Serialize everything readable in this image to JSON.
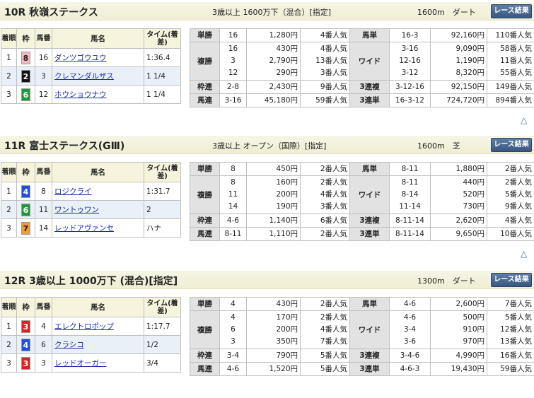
{
  "races": [
    {
      "title": "10R 秋嶺ステークス",
      "conditions": "3歳以上 1600万下（混合）[指定]",
      "distance": "1600m　ダート",
      "results_button": "レース結果",
      "headers": {
        "rank": "着順",
        "waku": "枠",
        "umaban": "馬番",
        "horse": "馬名",
        "time": "タイム(着差)"
      },
      "results": [
        {
          "rank": "1",
          "waku": "8",
          "waku_bg": "#f9b7c0",
          "waku_fg": "#222222",
          "umaban": "16",
          "horse": "ダンツゴウユウ",
          "time": "1:36.4"
        },
        {
          "rank": "2",
          "waku": "2",
          "waku_bg": "#111111",
          "waku_fg": "#ffffff",
          "umaban": "3",
          "horse": "クレマンダルザス",
          "time": "1 1/4"
        },
        {
          "rank": "3",
          "waku": "6",
          "waku_bg": "#1f9a3a",
          "waku_fg": "#ffffff",
          "umaban": "12",
          "horse": "ホウショウナウ",
          "time": "1 1/4"
        }
      ],
      "payouts": {
        "tansho": {
          "label": "単勝",
          "comb": "16",
          "amount": "1,280円",
          "pop": "4番人気"
        },
        "fukusho": {
          "label": "複勝",
          "combs": [
            "16",
            "3",
            "12"
          ],
          "amounts": [
            "430円",
            "2,790円",
            "290円"
          ],
          "pops": [
            "4番人気",
            "13番人気",
            "3番人気"
          ]
        },
        "wakuren": {
          "label": "枠連",
          "comb": "2-8",
          "amount": "2,430円",
          "pop": "9番人気"
        },
        "umaren": {
          "label": "馬連",
          "comb": "3-16",
          "amount": "45,180円",
          "pop": "59番人気"
        },
        "umatan": {
          "label": "馬単",
          "comb": "16-3",
          "amount": "92,160円",
          "pop": "110番人気"
        },
        "wide": {
          "label": "ワイド",
          "combs": [
            "3-16",
            "12-16",
            "3-12"
          ],
          "amounts": [
            "9,090円",
            "1,190円",
            "8,320円"
          ],
          "pops": [
            "58番人気",
            "11番人気",
            "55番人気"
          ]
        },
        "sanrenpuku": {
          "label": "3連複",
          "comb": "3-12-16",
          "amount": "92,150円",
          "pop": "149番人気"
        },
        "sanrentan": {
          "label": "3連単",
          "comb": "16-3-12",
          "amount": "724,720円",
          "pop": "894番人気"
        }
      }
    },
    {
      "title": "11R 富士ステークス(GⅢ)",
      "conditions": "3歳以上 オープン（国際）[指定]",
      "distance": "1600m　芝",
      "results_button": "レース結果",
      "headers": {
        "rank": "着順",
        "waku": "枠",
        "umaban": "馬番",
        "horse": "馬名",
        "time": "タイム(着差)"
      },
      "results": [
        {
          "rank": "1",
          "waku": "4",
          "waku_bg": "#1d4fd8",
          "waku_fg": "#ffffff",
          "umaban": "8",
          "horse": "ロジクライ",
          "time": "1:31.7"
        },
        {
          "rank": "2",
          "waku": "6",
          "waku_bg": "#1f9a3a",
          "waku_fg": "#ffffff",
          "umaban": "11",
          "horse": "ワントゥワン",
          "time": "2"
        },
        {
          "rank": "3",
          "waku": "7",
          "waku_bg": "#f39a3a",
          "waku_fg": "#222222",
          "umaban": "14",
          "horse": "レッドアヴァンセ",
          "time": "ハナ"
        }
      ],
      "payouts": {
        "tansho": {
          "label": "単勝",
          "comb": "8",
          "amount": "450円",
          "pop": "2番人気"
        },
        "fukusho": {
          "label": "複勝",
          "combs": [
            "8",
            "11",
            "14"
          ],
          "amounts": [
            "160円",
            "200円",
            "190円"
          ],
          "pops": [
            "2番人気",
            "4番人気",
            "3番人気"
          ]
        },
        "wakuren": {
          "label": "枠連",
          "comb": "4-6",
          "amount": "1,140円",
          "pop": "6番人気"
        },
        "umaren": {
          "label": "馬連",
          "comb": "8-11",
          "amount": "1,110円",
          "pop": "2番人気"
        },
        "umatan": {
          "label": "馬単",
          "comb": "8-11",
          "amount": "1,880円",
          "pop": "2番人気"
        },
        "wide": {
          "label": "ワイド",
          "combs": [
            "8-11",
            "8-14",
            "11-14"
          ],
          "amounts": [
            "440円",
            "520円",
            "730円"
          ],
          "pops": [
            "2番人気",
            "5番人気",
            "9番人気"
          ]
        },
        "sanrenpuku": {
          "label": "3連複",
          "comb": "8-11-14",
          "amount": "2,620円",
          "pop": "4番人気"
        },
        "sanrentan": {
          "label": "3連単",
          "comb": "8-11-14",
          "amount": "9,650円",
          "pop": "10番人気"
        }
      }
    },
    {
      "title": "12R 3歳以上 1000万下 (混合)[指定]",
      "conditions": "",
      "distance": "1300m　ダート",
      "results_button": "レース結果",
      "headers": {
        "rank": "着順",
        "waku": "枠",
        "umaban": "馬番",
        "horse": "馬名",
        "time": "タイム(着差)"
      },
      "results": [
        {
          "rank": "1",
          "waku": "3",
          "waku_bg": "#e02020",
          "waku_fg": "#ffffff",
          "umaban": "4",
          "horse": "エレクトロポップ",
          "time": "1:17.7"
        },
        {
          "rank": "2",
          "waku": "4",
          "waku_bg": "#1d4fd8",
          "waku_fg": "#ffffff",
          "umaban": "6",
          "horse": "クラシコ",
          "time": "1/2"
        },
        {
          "rank": "3",
          "waku": "3",
          "waku_bg": "#e02020",
          "waku_fg": "#ffffff",
          "umaban": "3",
          "horse": "レッドオーガー",
          "time": "3/4"
        }
      ],
      "payouts": {
        "tansho": {
          "label": "単勝",
          "comb": "4",
          "amount": "430円",
          "pop": "2番人気"
        },
        "fukusho": {
          "label": "複勝",
          "combs": [
            "4",
            "6",
            "3"
          ],
          "amounts": [
            "170円",
            "200円",
            "350円"
          ],
          "pops": [
            "2番人気",
            "4番人気",
            "7番人気"
          ]
        },
        "wakuren": {
          "label": "枠連",
          "comb": "3-4",
          "amount": "790円",
          "pop": "5番人気"
        },
        "umaren": {
          "label": "馬連",
          "comb": "4-6",
          "amount": "1,520円",
          "pop": "5番人気"
        },
        "umatan": {
          "label": "馬単",
          "comb": "4-6",
          "amount": "2,600円",
          "pop": "7番人気"
        },
        "wide": {
          "label": "ワイド",
          "combs": [
            "4-6",
            "3-4",
            "3-6"
          ],
          "amounts": [
            "500円",
            "910円",
            "970円"
          ],
          "pops": [
            "5番人気",
            "12番人気",
            "13番人気"
          ]
        },
        "sanrenpuku": {
          "label": "3連複",
          "comb": "3-4-6",
          "amount": "4,990円",
          "pop": "16番人気"
        },
        "sanrentan": {
          "label": "3連単",
          "comb": "4-6-3",
          "amount": "19,430円",
          "pop": "59番人気"
        }
      }
    }
  ],
  "up_icon": "up-triangle-icon"
}
